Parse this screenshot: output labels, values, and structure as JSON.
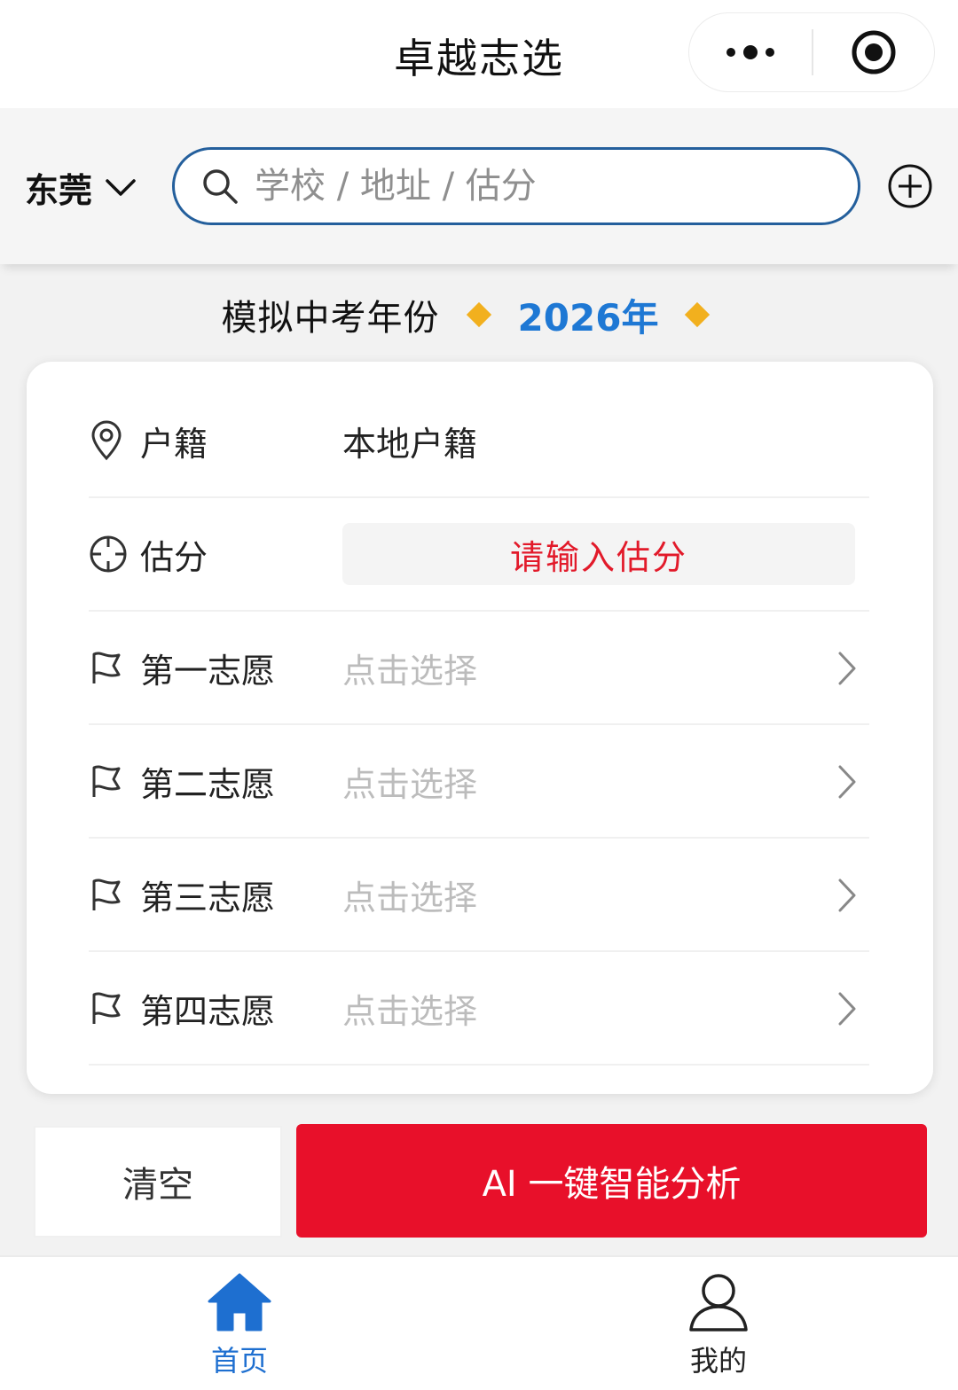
{
  "app": {
    "title": "卓越志选"
  },
  "header": {
    "city": "东莞",
    "search_placeholder": "学校 / 地址 / 估分"
  },
  "year": {
    "label": "模拟中考年份",
    "value": "2026年"
  },
  "form": {
    "residence": {
      "label": "户籍",
      "value": "本地户籍"
    },
    "score": {
      "label": "估分",
      "placeholder": "请输入估分"
    },
    "choices": [
      {
        "label": "第一志愿",
        "placeholder": "点击选择"
      },
      {
        "label": "第二志愿",
        "placeholder": "点击选择"
      },
      {
        "label": "第三志愿",
        "placeholder": "点击选择"
      },
      {
        "label": "第四志愿",
        "placeholder": "点击选择"
      }
    ]
  },
  "actions": {
    "clear_label": "清空",
    "analyze_label": "AI 一键智能分析"
  },
  "tabbar": {
    "items": [
      {
        "label": "首页",
        "icon": "home-icon",
        "active": true
      },
      {
        "label": "我的",
        "icon": "user-icon",
        "active": false
      }
    ]
  },
  "colors": {
    "accent_blue": "#1e78d4",
    "search_border": "#245f9c",
    "primary_red": "#e8102a",
    "diamond": "#f2b01e"
  }
}
